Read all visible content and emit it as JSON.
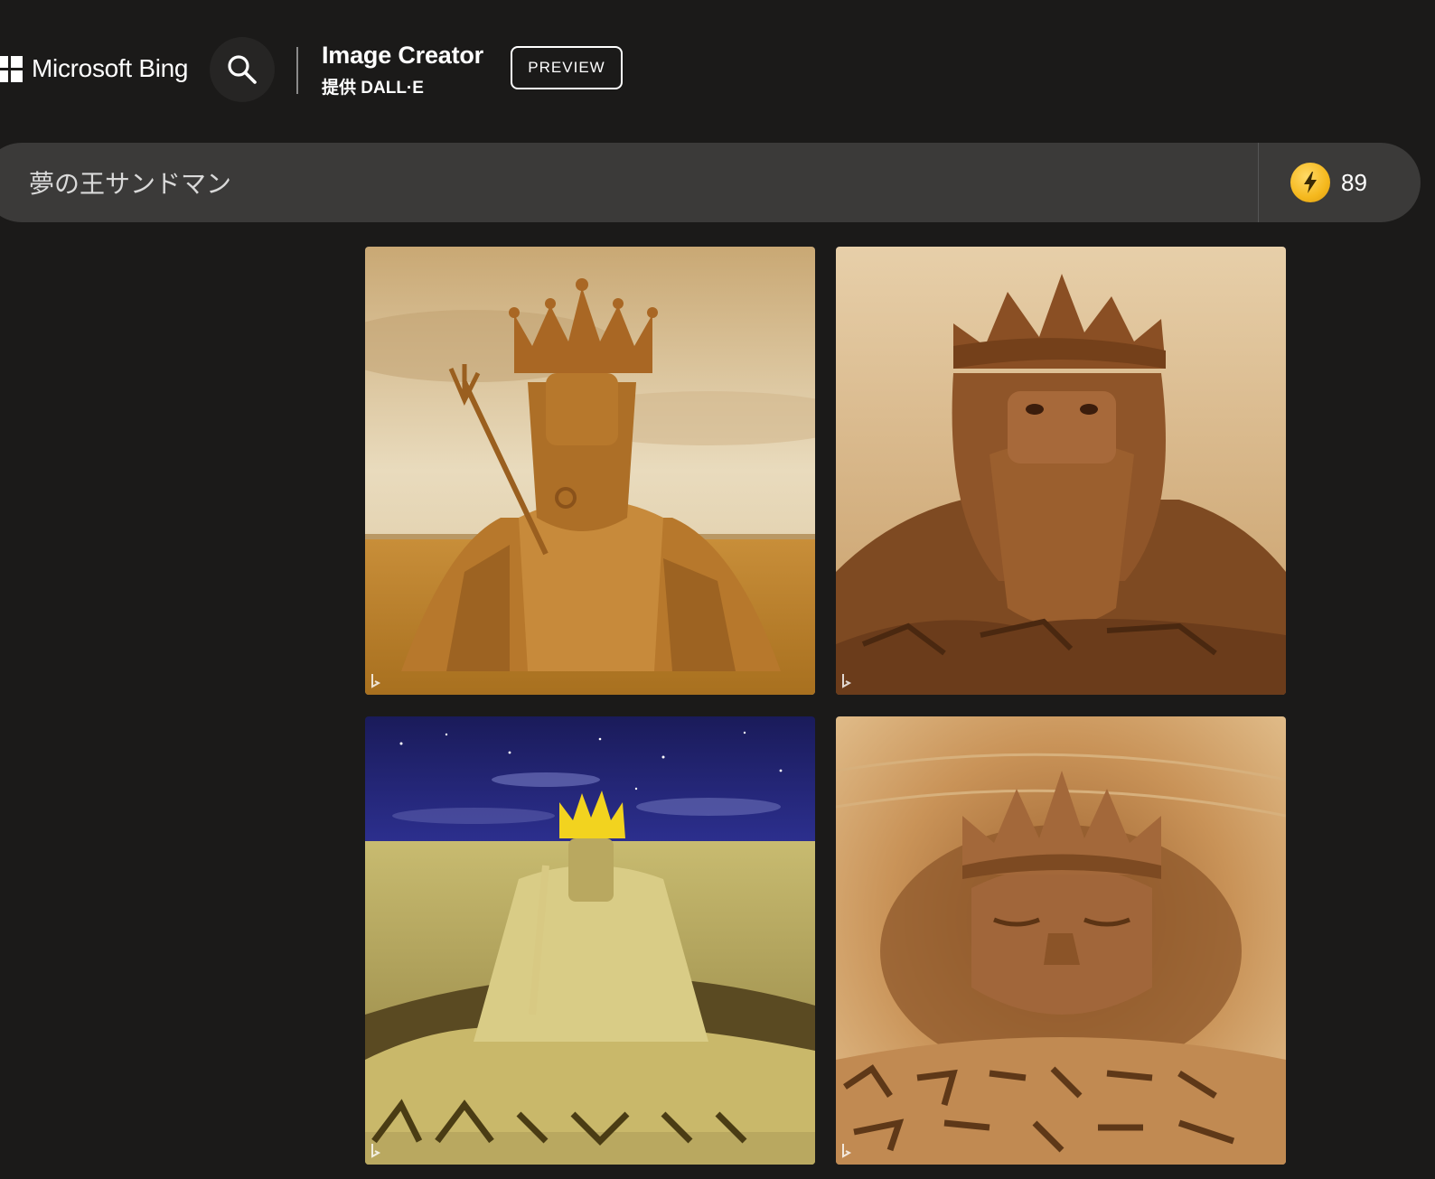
{
  "header": {
    "brand": "Microsoft Bing",
    "title": "Image Creator",
    "subtitle": "提供 DALL·E",
    "preview_label": "PREVIEW"
  },
  "prompt": {
    "value": "夢の王サンドマン"
  },
  "boosts": {
    "count": "89"
  },
  "results": [
    {
      "name": "result-image-1",
      "icon": "image"
    },
    {
      "name": "result-image-2",
      "icon": "image"
    },
    {
      "name": "result-image-3",
      "icon": "image"
    },
    {
      "name": "result-image-4",
      "icon": "image"
    }
  ],
  "colors": {
    "background": "#1b1a19",
    "prompt_bar": "#3b3a39",
    "boost_coin": "#f5b81d"
  }
}
